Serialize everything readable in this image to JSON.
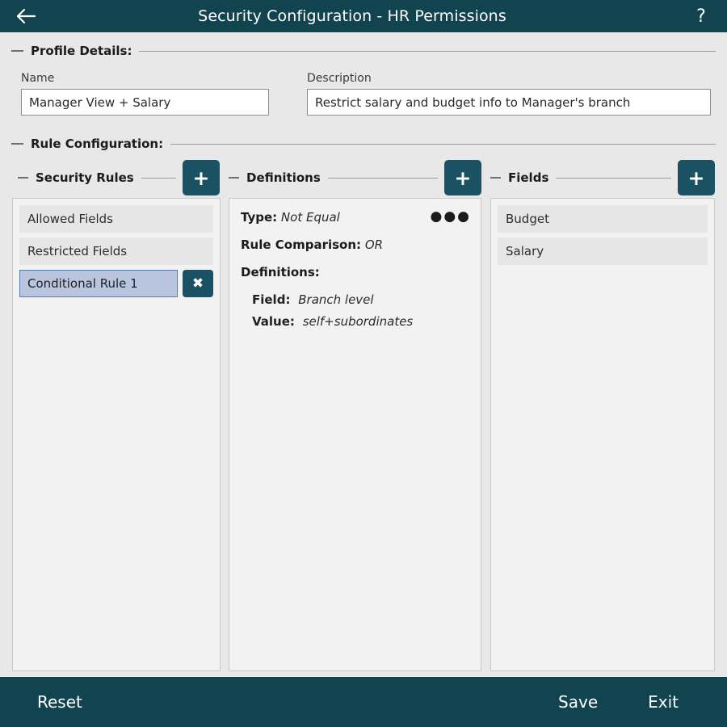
{
  "titlebar": {
    "title": "Security Configuration - HR Permissions",
    "back_icon": "back-arrow-icon",
    "help_label": "?"
  },
  "profile_details": {
    "legend": "Profile Details:",
    "name": {
      "label": "Name",
      "value": "Manager View + Salary",
      "placeholder": "Name"
    },
    "description": {
      "label": "Description",
      "value": "Restrict salary and budget info to Manager's branch",
      "placeholder": "Description"
    }
  },
  "rule_configuration": {
    "legend": "Rule Configuration:",
    "security_rules": {
      "title": "Security Rules",
      "add_label": "+",
      "items": [
        {
          "label": "Allowed Fields",
          "selected": false
        },
        {
          "label": "Restricted Fields",
          "selected": false
        },
        {
          "label": "Conditional Rule 1",
          "selected": true,
          "delete_label": "✖"
        }
      ]
    },
    "definitions": {
      "title": "Definitions",
      "add_label": "+",
      "menu_label": "●●●",
      "type": {
        "label": "Type:",
        "value": "Not Equal"
      },
      "rule_comparison": {
        "label": "Rule Comparison:",
        "value": "OR"
      },
      "definitions_label": "Definitions:",
      "entries": [
        {
          "label": "Field:",
          "value": "Branch level"
        },
        {
          "label": "Value:",
          "value": "self+subordinates"
        }
      ]
    },
    "fields": {
      "title": "Fields",
      "add_label": "+",
      "items": [
        {
          "label": "Budget"
        },
        {
          "label": "Salary"
        }
      ]
    }
  },
  "bottombar": {
    "reset_label": "Reset",
    "save_label": "Save",
    "exit_label": "Exit"
  },
  "colors": {
    "header_teal": "#12444f",
    "accent_teal": "#1b5263",
    "page_bg": "#e8e8e8",
    "panel_bg": "#f2f2f2",
    "selection_blue": "#b9c5de",
    "selection_border": "#5d77ab"
  }
}
